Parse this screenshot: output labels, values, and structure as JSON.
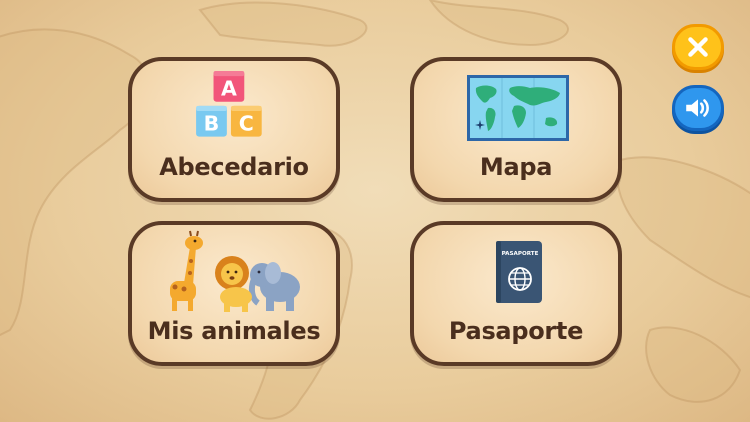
{
  "menu": {
    "alphabet_label": "Abecedario",
    "map_label": "Mapa",
    "animals_label": "Mis animales",
    "passport_label": "Pasaporte"
  },
  "blocks": [
    "A",
    "B",
    "C"
  ],
  "passport_word": "PASAPORTE",
  "icons": {
    "close": "close-icon",
    "sound": "speaker-icon",
    "alphabet": "abc-blocks-icon",
    "map": "world-map-icon",
    "animals": "giraffe-lion-elephant-icon",
    "passport": "passport-icon"
  },
  "colors": {
    "card_border": "#5a3a26",
    "label_text": "#4a2e1d",
    "close_button": "#ffc21a",
    "sound_button": "#2f97ee"
  }
}
